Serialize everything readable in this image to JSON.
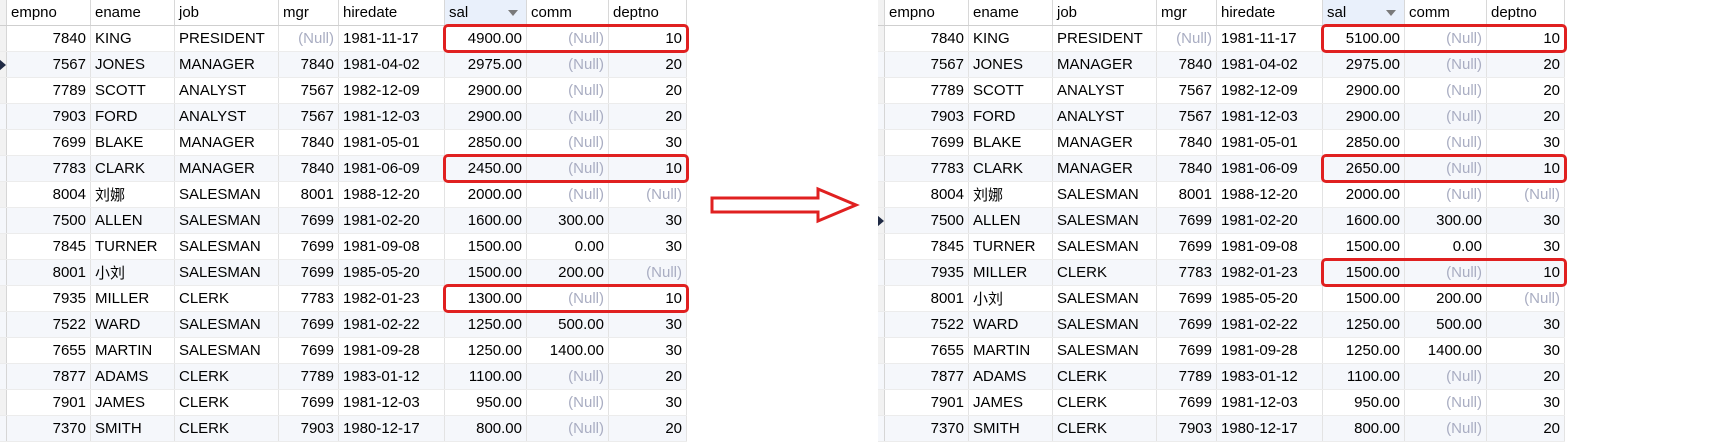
{
  "columns": [
    "empno",
    "ename",
    "job",
    "mgr",
    "hiredate",
    "sal",
    "comm",
    "deptno"
  ],
  "sorted_column": "sal",
  "null_text": "(Null)",
  "colors": {
    "highlight": "#e02020",
    "null_text": "#a9adc2",
    "sorted_header": "#e9f0fb"
  },
  "before": {
    "current_row": 1,
    "rows": [
      [
        "7840",
        "KING",
        "PRESIDENT",
        "(Null)",
        "1981-11-17",
        "4900.00",
        "(Null)",
        "10"
      ],
      [
        "7567",
        "JONES",
        "MANAGER",
        "7840",
        "1981-04-02",
        "2975.00",
        "(Null)",
        "20"
      ],
      [
        "7789",
        "SCOTT",
        "ANALYST",
        "7567",
        "1982-12-09",
        "2900.00",
        "(Null)",
        "20"
      ],
      [
        "7903",
        "FORD",
        "ANALYST",
        "7567",
        "1981-12-03",
        "2900.00",
        "(Null)",
        "20"
      ],
      [
        "7699",
        "BLAKE",
        "MANAGER",
        "7840",
        "1981-05-01",
        "2850.00",
        "(Null)",
        "30"
      ],
      [
        "7783",
        "CLARK",
        "MANAGER",
        "7840",
        "1981-06-09",
        "2450.00",
        "(Null)",
        "10"
      ],
      [
        "8004",
        "刘娜",
        "SALESMAN",
        "8001",
        "1988-12-20",
        "2000.00",
        "(Null)",
        "(Null)"
      ],
      [
        "7500",
        "ALLEN",
        "SALESMAN",
        "7699",
        "1981-02-20",
        "1600.00",
        "300.00",
        "30"
      ],
      [
        "7845",
        "TURNER",
        "SALESMAN",
        "7699",
        "1981-09-08",
        "1500.00",
        "0.00",
        "30"
      ],
      [
        "8001",
        "小刘",
        "SALESMAN",
        "7699",
        "1985-05-20",
        "1500.00",
        "200.00",
        "(Null)"
      ],
      [
        "7935",
        "MILLER",
        "CLERK",
        "7783",
        "1982-01-23",
        "1300.00",
        "(Null)",
        "10"
      ],
      [
        "7522",
        "WARD",
        "SALESMAN",
        "7699",
        "1981-02-22",
        "1250.00",
        "500.00",
        "30"
      ],
      [
        "7655",
        "MARTIN",
        "SALESMAN",
        "7699",
        "1981-09-28",
        "1250.00",
        "1400.00",
        "30"
      ],
      [
        "7877",
        "ADAMS",
        "CLERK",
        "7789",
        "1983-01-12",
        "1100.00",
        "(Null)",
        "20"
      ],
      [
        "7901",
        "JAMES",
        "CLERK",
        "7699",
        "1981-12-03",
        "950.00",
        "(Null)",
        "30"
      ],
      [
        "7370",
        "SMITH",
        "CLERK",
        "7903",
        "1980-12-17",
        "800.00",
        "(Null)",
        "20"
      ]
    ],
    "highlighted_rows": [
      0,
      5,
      10
    ]
  },
  "after": {
    "current_row": 7,
    "rows": [
      [
        "7840",
        "KING",
        "PRESIDENT",
        "(Null)",
        "1981-11-17",
        "5100.00",
        "(Null)",
        "10"
      ],
      [
        "7567",
        "JONES",
        "MANAGER",
        "7840",
        "1981-04-02",
        "2975.00",
        "(Null)",
        "20"
      ],
      [
        "7789",
        "SCOTT",
        "ANALYST",
        "7567",
        "1982-12-09",
        "2900.00",
        "(Null)",
        "20"
      ],
      [
        "7903",
        "FORD",
        "ANALYST",
        "7567",
        "1981-12-03",
        "2900.00",
        "(Null)",
        "20"
      ],
      [
        "7699",
        "BLAKE",
        "MANAGER",
        "7840",
        "1981-05-01",
        "2850.00",
        "(Null)",
        "30"
      ],
      [
        "7783",
        "CLARK",
        "MANAGER",
        "7840",
        "1981-06-09",
        "2650.00",
        "(Null)",
        "10"
      ],
      [
        "8004",
        "刘娜",
        "SALESMAN",
        "8001",
        "1988-12-20",
        "2000.00",
        "(Null)",
        "(Null)"
      ],
      [
        "7500",
        "ALLEN",
        "SALESMAN",
        "7699",
        "1981-02-20",
        "1600.00",
        "300.00",
        "30"
      ],
      [
        "7845",
        "TURNER",
        "SALESMAN",
        "7699",
        "1981-09-08",
        "1500.00",
        "0.00",
        "30"
      ],
      [
        "7935",
        "MILLER",
        "CLERK",
        "7783",
        "1982-01-23",
        "1500.00",
        "(Null)",
        "10"
      ],
      [
        "8001",
        "小刘",
        "SALESMAN",
        "7699",
        "1985-05-20",
        "1500.00",
        "200.00",
        "(Null)"
      ],
      [
        "7522",
        "WARD",
        "SALESMAN",
        "7699",
        "1981-02-22",
        "1250.00",
        "500.00",
        "30"
      ],
      [
        "7655",
        "MARTIN",
        "SALESMAN",
        "7699",
        "1981-09-28",
        "1250.00",
        "1400.00",
        "30"
      ],
      [
        "7877",
        "ADAMS",
        "CLERK",
        "7789",
        "1983-01-12",
        "1100.00",
        "(Null)",
        "20"
      ],
      [
        "7901",
        "JAMES",
        "CLERK",
        "7699",
        "1981-12-03",
        "950.00",
        "(Null)",
        "30"
      ],
      [
        "7370",
        "SMITH",
        "CLERK",
        "7903",
        "1980-12-17",
        "800.00",
        "(Null)",
        "20"
      ]
    ],
    "highlighted_rows": [
      0,
      5,
      9
    ]
  }
}
